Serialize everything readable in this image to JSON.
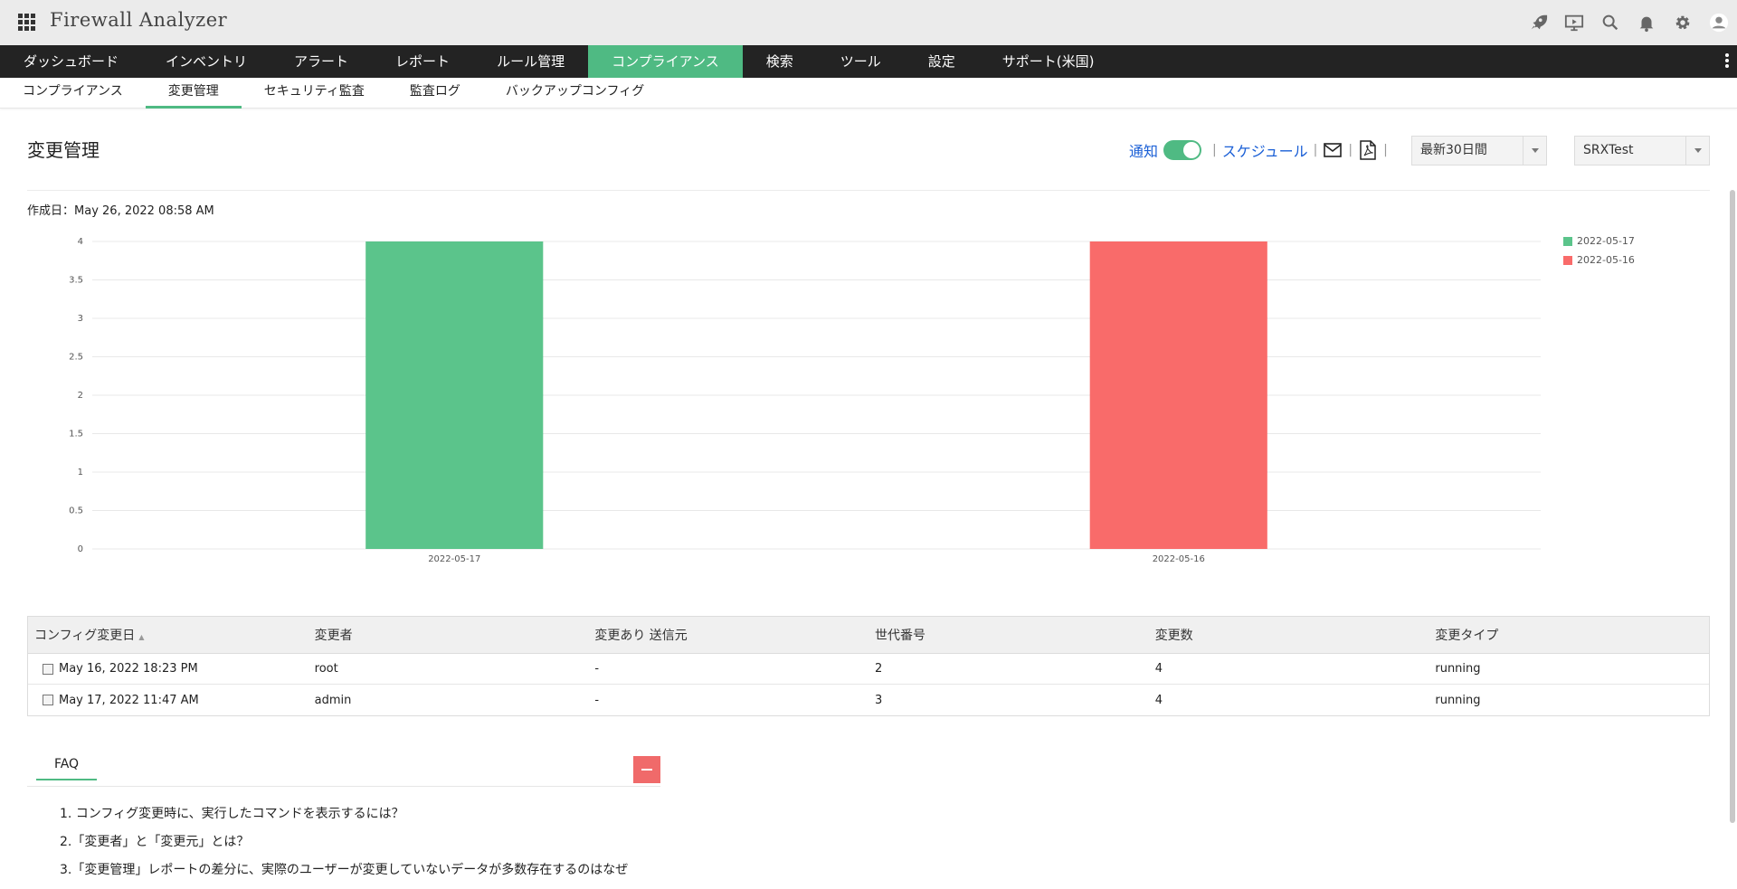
{
  "app": {
    "title": "Firewall Analyzer"
  },
  "top_icons": [
    {
      "name": "rocket-icon"
    },
    {
      "name": "presentation-icon"
    },
    {
      "name": "search-icon"
    },
    {
      "name": "bell-icon"
    },
    {
      "name": "gear-icon"
    },
    {
      "name": "user-avatar-icon"
    }
  ],
  "main_nav": {
    "items": [
      {
        "label": "ダッシュボード",
        "active": false
      },
      {
        "label": "インベントリ",
        "active": false
      },
      {
        "label": "アラート",
        "active": false
      },
      {
        "label": "レポート",
        "active": false
      },
      {
        "label": "ルール管理",
        "active": false
      },
      {
        "label": "コンプライアンス",
        "active": true
      },
      {
        "label": "検索",
        "active": false
      },
      {
        "label": "ツール",
        "active": false
      },
      {
        "label": "設定",
        "active": false
      },
      {
        "label": "サポート(米国)",
        "active": false
      }
    ]
  },
  "sub_nav": {
    "items": [
      {
        "label": "コンプライアンス",
        "active": false
      },
      {
        "label": "変更管理",
        "active": true
      },
      {
        "label": "セキュリティ監査",
        "active": false
      },
      {
        "label": "監査ログ",
        "active": false
      },
      {
        "label": "バックアップコンフィグ",
        "active": false
      }
    ]
  },
  "page": {
    "title": "変更管理",
    "notify_label": "通知",
    "notify_on": true,
    "schedule_label": "スケジュール",
    "sep": "|",
    "period_select": "最新30日間",
    "device_select": "SRXTest",
    "created_label": "作成日：",
    "created_value": "May 26, 2022 08:58 AM"
  },
  "colors": {
    "accent": "#4fba83",
    "nav_bg": "#232323",
    "series_1": "#5bc48b",
    "series_2": "#f96b6a"
  },
  "chart_data": {
    "type": "bar",
    "categories": [
      "2022-05-17",
      "2022-05-16"
    ],
    "values": [
      4,
      4
    ],
    "colors": [
      "#5bc48b",
      "#f96b6a"
    ],
    "legend": [
      "2022-05-17",
      "2022-05-16"
    ],
    "legend_position": "top-right",
    "ylim": [
      0,
      4
    ],
    "yticks": [
      "0",
      "0.5",
      "1",
      "1.5",
      "2",
      "2.5",
      "3",
      "3.5",
      "4"
    ],
    "grid": true,
    "title": "",
    "xlabel": "",
    "ylabel": ""
  },
  "table": {
    "columns": [
      "コンフィグ変更日",
      "変更者",
      "変更あり 送信元",
      "世代番号",
      "変更数",
      "変更タイプ"
    ],
    "sort_arrow": "▲",
    "rows": [
      [
        "May 16, 2022 18:23 PM",
        "root",
        "-",
        "2",
        "4",
        "running"
      ],
      [
        "May 17, 2022 11:47 AM",
        "admin",
        "-",
        "3",
        "4",
        "running"
      ]
    ]
  },
  "faq": {
    "tab_label": "FAQ",
    "questions": [
      "1. コンフィグ変更時に、実行したコマンドを表示するには？",
      "2.「変更者」と「変更元」とは？",
      "3.「変更管理」レポートの差分に、実際のユーザーが変更していないデータが多数存在するのはなぜ"
    ]
  }
}
